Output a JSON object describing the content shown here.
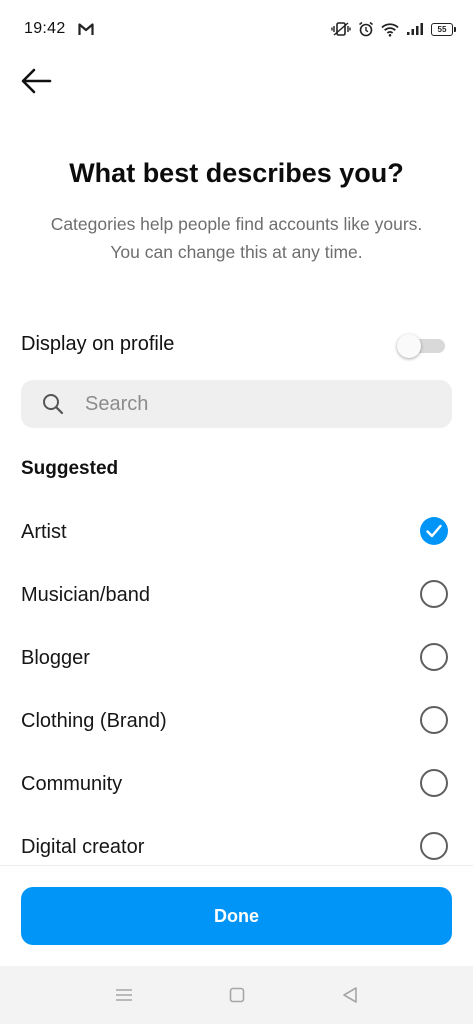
{
  "status_bar": {
    "time": "19:42",
    "battery": "55",
    "icons": [
      "gmail-icon",
      "vibrate-icon",
      "alarm-icon",
      "wifi-icon",
      "signal-icon",
      "battery-icon"
    ]
  },
  "header": {
    "back_icon": "arrow-left-icon",
    "title": "What best describes you?",
    "subtitle_line1": "Categories help people find accounts like yours.",
    "subtitle_line2": "You can change this at any time."
  },
  "display_on_profile": {
    "label": "Display on profile",
    "enabled": false
  },
  "search": {
    "placeholder": "Search",
    "value": ""
  },
  "suggested": {
    "heading": "Suggested",
    "items": [
      {
        "label": "Artist",
        "selected": true
      },
      {
        "label": "Musician/band",
        "selected": false
      },
      {
        "label": "Blogger",
        "selected": false
      },
      {
        "label": "Clothing (Brand)",
        "selected": false
      },
      {
        "label": "Community",
        "selected": false
      },
      {
        "label": "Digital creator",
        "selected": false
      }
    ]
  },
  "footer": {
    "done_label": "Done"
  },
  "colors": {
    "accent": "#0095f6",
    "text_primary": "#111111",
    "text_secondary": "#6e6e6e",
    "search_bg": "#efefef"
  },
  "nav_bar": {
    "icons": [
      "menu-icon",
      "home-square-icon",
      "back-triangle-icon"
    ]
  }
}
